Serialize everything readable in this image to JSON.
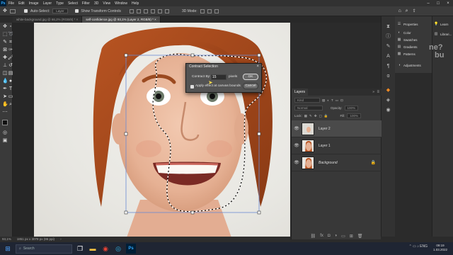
{
  "app": {
    "logo": "Ps",
    "menu": [
      "File",
      "Edit",
      "Image",
      "Layer",
      "Type",
      "Select",
      "Filter",
      "3D",
      "View",
      "Window",
      "Help"
    ]
  },
  "options_bar": {
    "auto_select_label": "Auto-Select:",
    "auto_select_value": "Layer",
    "transform_label": "Show Transform Controls",
    "mode_3d": "3D Mode:"
  },
  "tabs": [
    {
      "label": "white-background.jpg @ 66,2% (RGB/8) *  ×"
    },
    {
      "label": "self-confidence.jpg @ 93,1% (Layer 2, RGB/8) *  ×"
    }
  ],
  "dialog": {
    "title": "Contract Selection",
    "close": "×",
    "contract_label": "Contract By:",
    "contract_value": "15",
    "units": "pixels",
    "ok_label": "OK",
    "cancel_label": "Cancel",
    "apply_label": "Apply effect at canvas bounds"
  },
  "panels": {
    "properties": "Properties",
    "color": "Color",
    "swatches": "Swatches",
    "gradients": "Gradients",
    "patterns": "Patterns",
    "adjustments": "Adjustments",
    "learn": "Learn",
    "libraries": "Librari..."
  },
  "layers": {
    "tab_label": "Layers",
    "kind": "Kind",
    "blend_mode": "Normal",
    "opacity_label": "Opacity:",
    "opacity_value": "100%",
    "lock_label": "Lock:",
    "fill_label": "Fill:",
    "fill_value": "100%",
    "items": [
      {
        "name": "Layer 2",
        "selected": true
      },
      {
        "name": "Layer 1",
        "selected": false
      },
      {
        "name": "Background",
        "selected": false
      }
    ]
  },
  "status": {
    "zoom": "93,1%",
    "doc_size": "1851 px x 3078 px (96 ppi)"
  },
  "taskbar": {
    "search_placeholder": "Search",
    "time": "09:19",
    "date": "1.03.2022"
  },
  "watermark": {
    "line1": "ne?",
    "line2": "bu"
  }
}
